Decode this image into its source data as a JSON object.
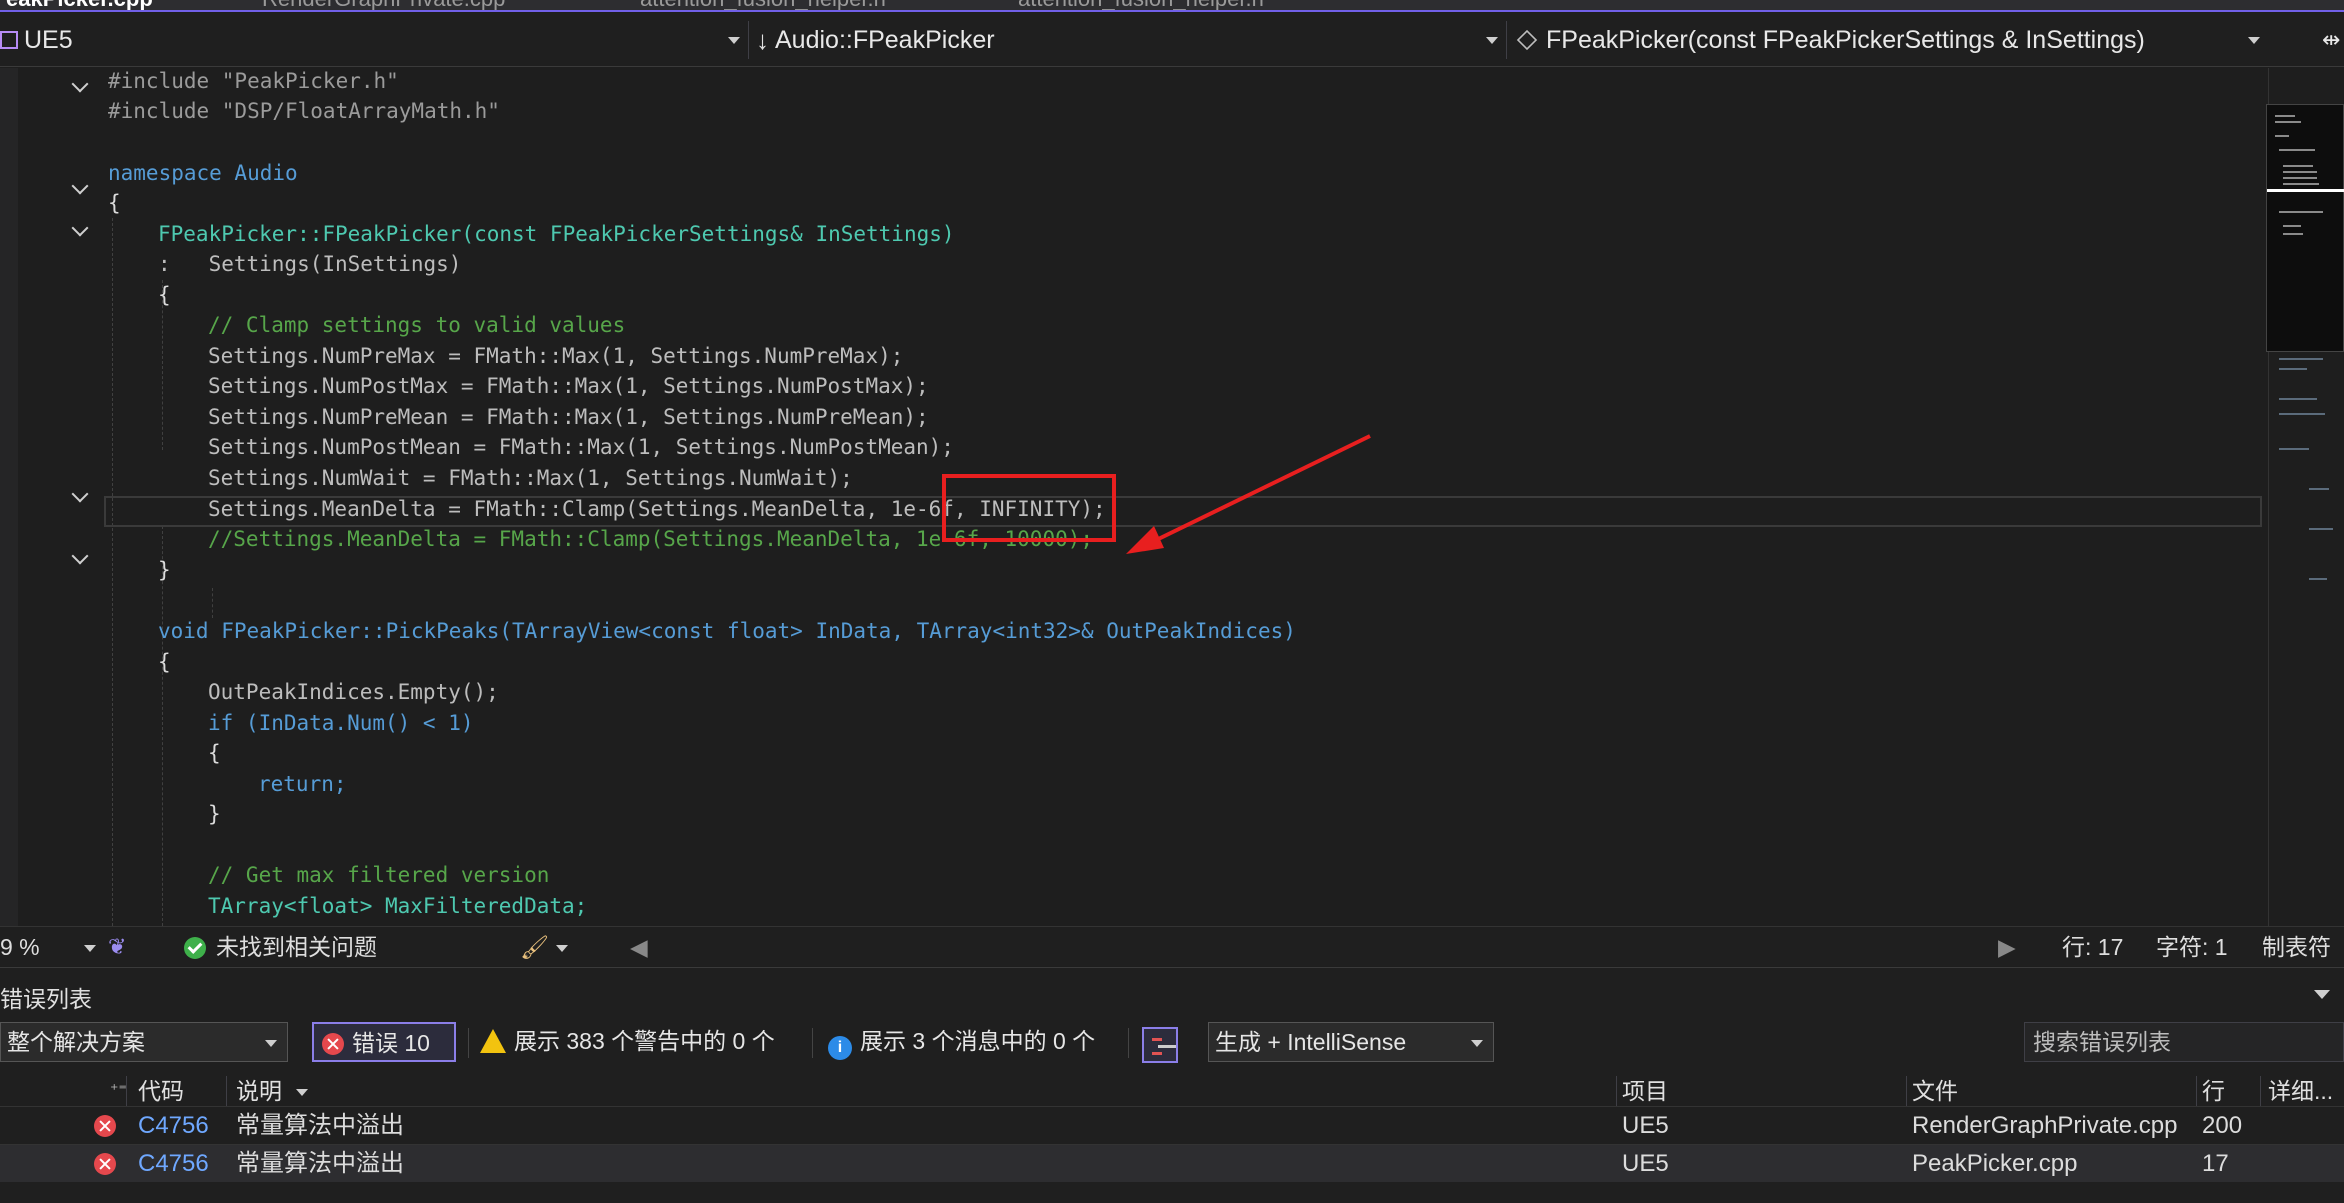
{
  "tabs": [
    {
      "label": "eakPicker.cpp",
      "active": true
    },
    {
      "label": "RenderGraphPrivate.cpp",
      "active": false
    },
    {
      "label": "attention_fusion_helper.h",
      "active": false
    },
    {
      "label": "attention_fusion_helper.h",
      "active": false
    }
  ],
  "navbar": {
    "project": "UE5",
    "scope": "Audio::FPeakPicker",
    "member": "FPeakPicker(const FPeakPickerSettings & InSettings)"
  },
  "code": {
    "lines": [
      [
        "#include \"PeakPicker.h\""
      ],
      [
        "#include \"DSP/FloatArrayMath.h\""
      ],
      [
        ""
      ],
      [
        "namespace Audio"
      ],
      [
        "{"
      ],
      [
        "FPeakPicker::FPeakPicker(const FPeakPickerSettings& InSettings)"
      ],
      [
        ":   Settings(InSettings)"
      ],
      [
        "{"
      ],
      [
        "// Clamp settings to valid values"
      ],
      [
        "Settings.NumPreMax = FMath::Max(1, Settings.NumPreMax);"
      ],
      [
        "Settings.NumPostMax = FMath::Max(1, Settings.NumPostMax);"
      ],
      [
        "Settings.NumPreMean = FMath::Max(1, Settings.NumPreMean);"
      ],
      [
        "Settings.NumPostMean = FMath::Max(1, Settings.NumPostMean);"
      ],
      [
        "Settings.NumWait = FMath::Max(1, Settings.NumWait);"
      ],
      [
        "Settings.MeanDelta = FMath::Clamp(Settings.MeanDelta, 1e-6f, INFINITY);"
      ],
      [
        "//Settings.MeanDelta = FMath::Clamp(Settings.MeanDelta, 1e-6f, 10000);"
      ],
      [
        "}"
      ],
      [
        ""
      ],
      [
        "void FPeakPicker::PickPeaks(TArrayView<const float> InData, TArray<int32>& OutPeakIndices)"
      ],
      [
        "{"
      ],
      [
        "OutPeakIndices.Empty();"
      ],
      [
        "if (InData.Num() < 1)"
      ],
      [
        "{"
      ],
      [
        "return;"
      ],
      [
        "}"
      ],
      [
        ""
      ],
      [
        "// Get max filtered version"
      ],
      [
        "TArray<float> MaxFilteredData;"
      ]
    ]
  },
  "statusbar": {
    "zoom": "9 %",
    "issues": "未找到相关问题",
    "line": "行: 17",
    "char": "字符: 1",
    "indent": "制表符"
  },
  "error_list": {
    "title": "错误列表",
    "scope": "整个解决方案",
    "errors_label": "错误 10",
    "warnings_label": "展示 383 个警告中的 0 个",
    "messages_label": "展示 3 个消息中的 0 个",
    "source": "生成 + IntelliSense",
    "search_placeholder": "搜索错误列表",
    "columns": {
      "code": "代码",
      "description": "说明",
      "project": "项目",
      "file": "文件",
      "line": "行",
      "detail": "详细..."
    },
    "rows": [
      {
        "code": "C4756",
        "description": "常量算法中溢出",
        "project": "UE5",
        "file": "RenderGraphPrivate.cpp",
        "line": "200"
      },
      {
        "code": "C4756",
        "description": "常量算法中溢出",
        "project": "UE5",
        "file": "PeakPicker.cpp",
        "line": "17"
      }
    ]
  }
}
